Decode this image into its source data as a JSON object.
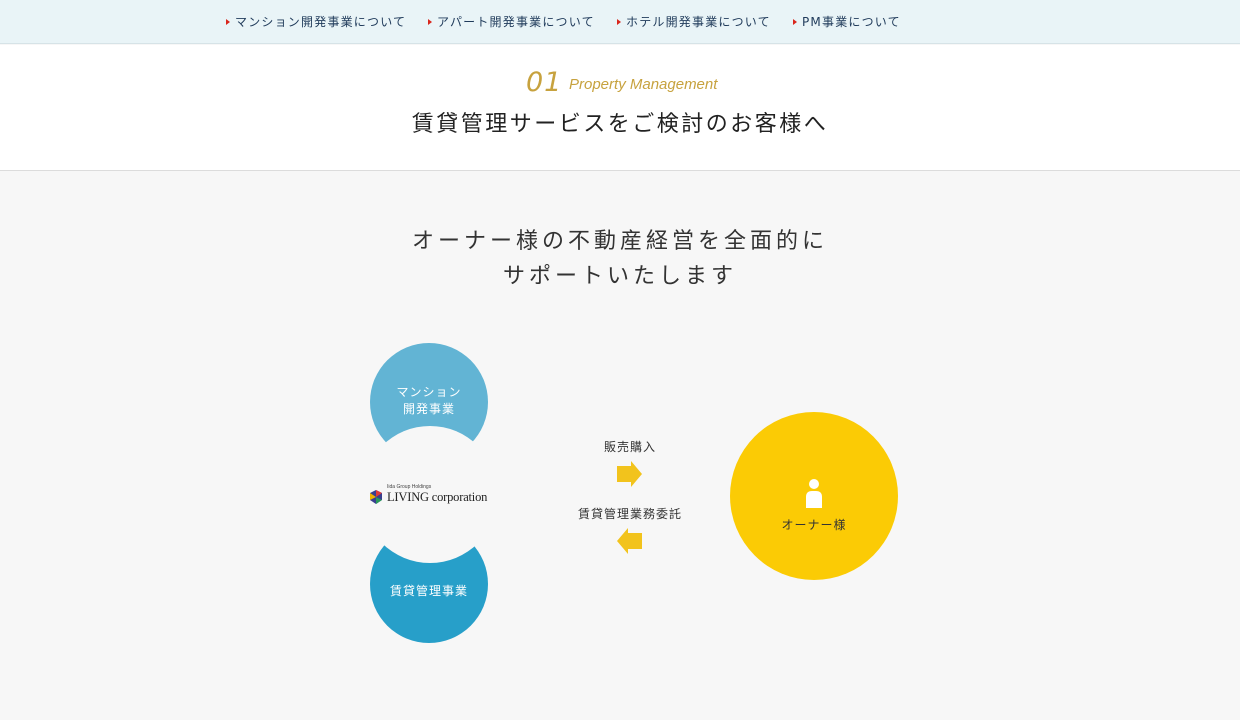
{
  "nav": {
    "items": [
      {
        "label": "マンション開発事業について"
      },
      {
        "label": "アパート開発事業について"
      },
      {
        "label": "ホテル開発事業について"
      },
      {
        "label": "PM事業について"
      }
    ]
  },
  "section": {
    "number": "01",
    "subtitle_en": "Property Management",
    "title": "賃貸管理サービスをご検討のお客様へ"
  },
  "lead": {
    "line1": "オーナー様の不動産経営を全面的に",
    "line2": "サポートいたします"
  },
  "diagram": {
    "bubble_top_line1": "マンション",
    "bubble_top_line2": "開発事業",
    "bubble_bottom": "賃貸管理事業",
    "logo_sub": "Iida Group Holdings",
    "logo_main": "LIVING corporation",
    "arrow_right_label": "販売購入",
    "arrow_left_label": "賃貸管理業務委託",
    "owner_label": "オーナー様"
  },
  "colors": {
    "nav_bg": "#e9f4f7",
    "accent_gold": "#c7a23e",
    "bubble_light_blue": "#62b4d4",
    "bubble_blue": "#279fc9",
    "owner_yellow": "#fbcb05",
    "arrow_yellow": "#f2c31c",
    "nav_marker_red": "#d9261c"
  },
  "icons": {
    "nav_marker": "triangle-right-icon",
    "owner": "person-icon",
    "arrow_right": "arrow-right-icon",
    "arrow_left": "arrow-left-icon"
  }
}
